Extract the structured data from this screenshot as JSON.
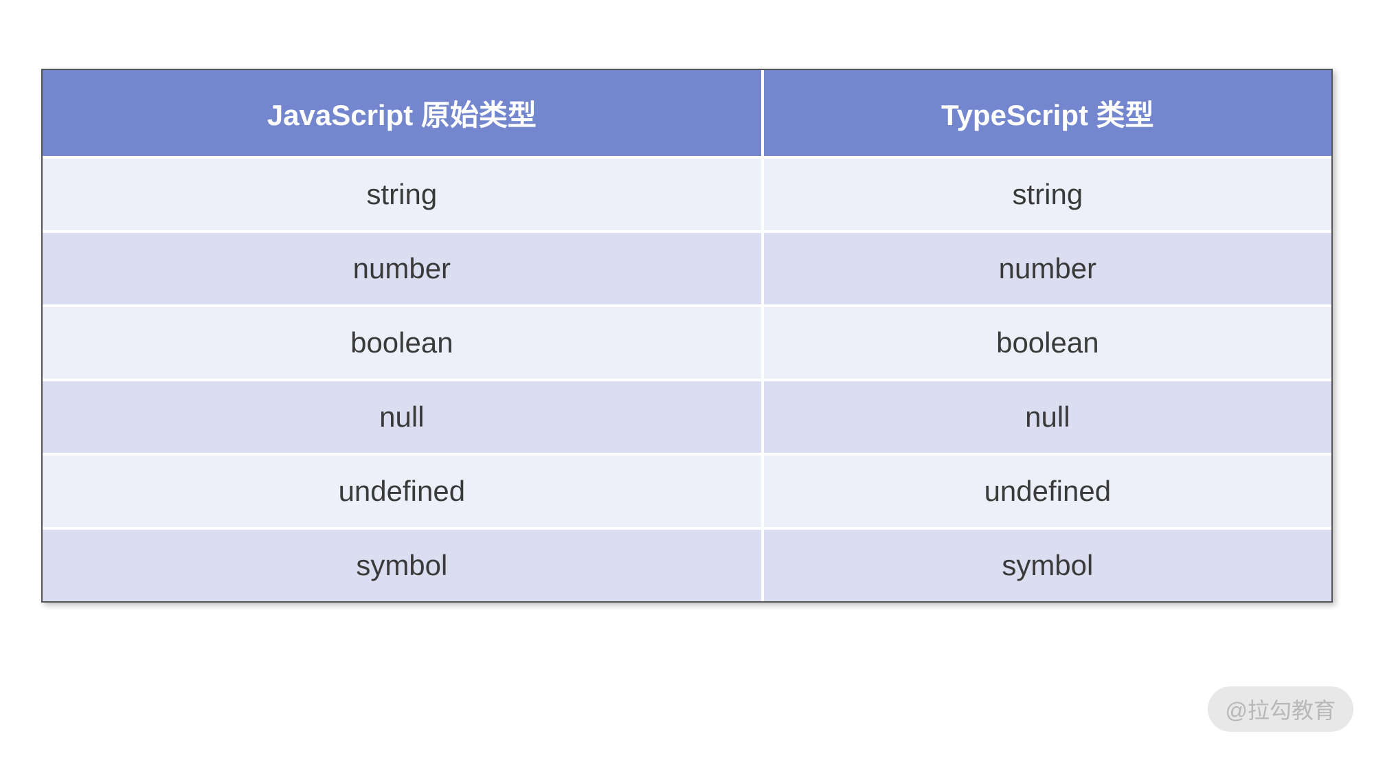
{
  "table": {
    "headers": [
      "JavaScript 原始类型",
      "TypeScript 类型"
    ],
    "rows": [
      [
        "string",
        "string"
      ],
      [
        "number",
        "number"
      ],
      [
        "boolean",
        "boolean"
      ],
      [
        "null",
        "null"
      ],
      [
        "undefined",
        "undefined"
      ],
      [
        "symbol",
        "symbol"
      ]
    ]
  },
  "watermark": "@拉勾教育"
}
